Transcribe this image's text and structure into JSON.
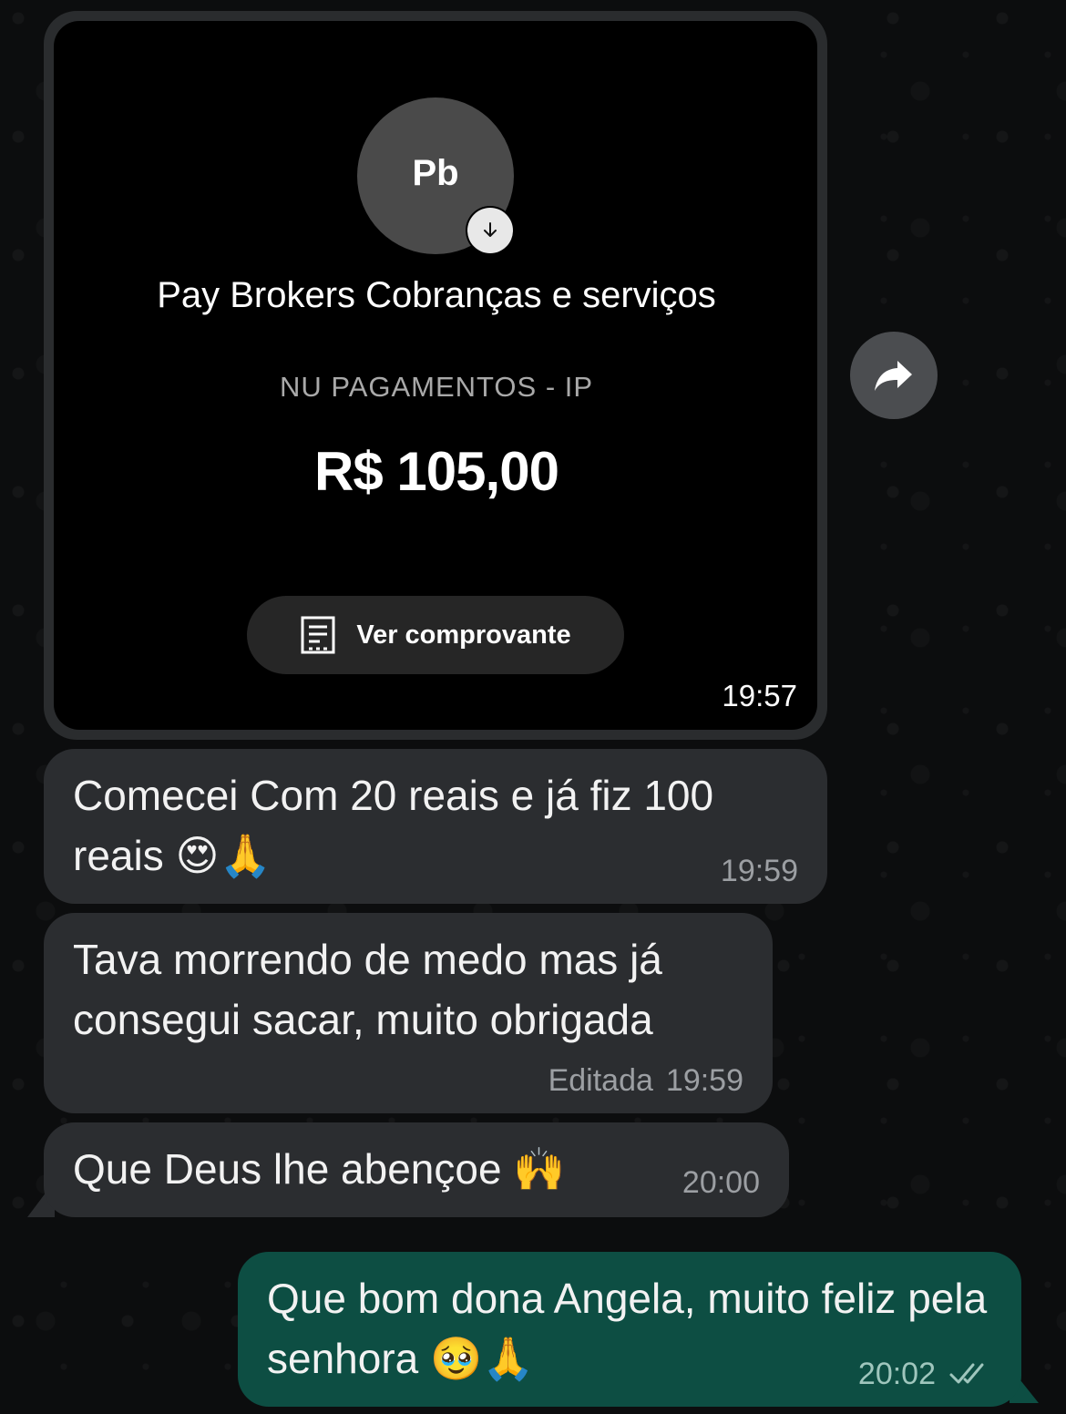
{
  "image_message": {
    "avatar_initials": "Pb",
    "payee_name": "Pay Brokers Cobranças e serviços",
    "payee_bank": "NU PAGAMENTOS - IP",
    "amount": "R$ 105,00",
    "receipt_button_label": "Ver comprovante",
    "time": "19:57"
  },
  "messages": [
    {
      "text": "Comecei Com 20 reais e já fiz 100 reais",
      "emojis": "😍🙏",
      "time": "19:59"
    },
    {
      "text": "Tava morrendo de medo mas já consegui sacar, muito obrigada",
      "edited_label": "Editada",
      "time": "19:59"
    },
    {
      "text": "Que Deus lhe abençoe",
      "emojis": "🙌",
      "time": "20:00"
    },
    {
      "text": "Que bom dona Angela, muito feliz pela senhora",
      "emojis": "🥹🙏",
      "time": "20:02",
      "status": "read"
    }
  ],
  "colors": {
    "incoming_bubble": "#2b2d30",
    "outgoing_bubble": "#0d4e43",
    "read_ticks": "#9fc6bd"
  },
  "icons": {
    "forward": "forward-arrow-icon",
    "receipt": "receipt-icon",
    "download": "download-arrow-icon",
    "read_status": "double-check-icon"
  }
}
